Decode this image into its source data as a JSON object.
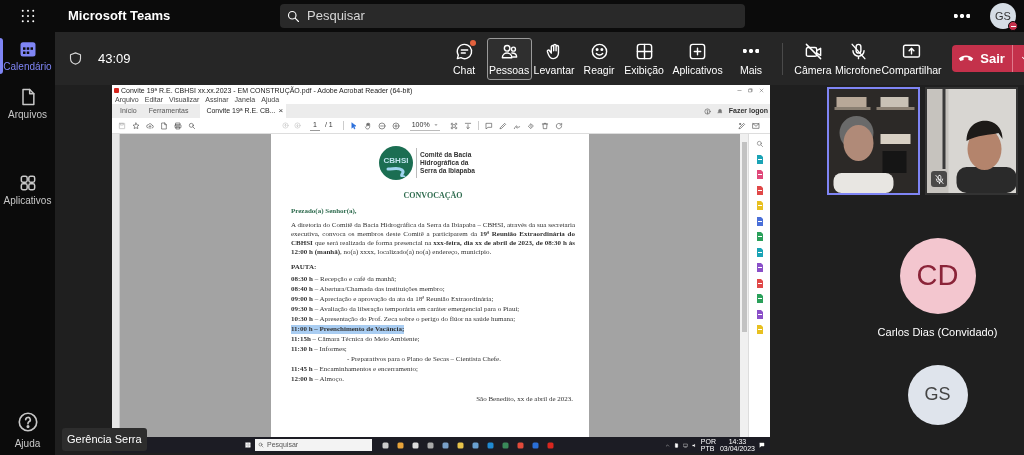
{
  "app": {
    "title": "Microsoft Teams",
    "search_placeholder": "Pesquisar",
    "avatar_initials": "GS",
    "busy": true
  },
  "rail": [
    {
      "label": "Calendário",
      "selected": true
    },
    {
      "label": "Arquivos",
      "selected": false
    },
    {
      "label": "Aplicativos",
      "selected": false
    }
  ],
  "help": "Ajuda",
  "meeting": {
    "timer": "43:09",
    "controls": [
      {
        "label": "Chat",
        "selected": false,
        "badge": true
      },
      {
        "label": "Pessoas",
        "selected": true,
        "badge": false
      },
      {
        "label": "Levantar",
        "selected": false,
        "badge": false
      },
      {
        "label": "Reagir",
        "selected": false,
        "badge": false
      },
      {
        "label": "Exibição",
        "selected": false,
        "badge": false
      },
      {
        "label": "Aplicativos",
        "selected": false,
        "badge": false
      },
      {
        "label": "Mais",
        "selected": false,
        "badge": false
      }
    ],
    "device_controls": [
      {
        "label": "Câmera",
        "selected": false,
        "badge": false
      },
      {
        "label": "Microfone",
        "selected": false,
        "badge": false
      },
      {
        "label": "Compartilhar",
        "selected": false,
        "badge": false
      }
    ],
    "leave": "Sair"
  },
  "shared_screen": {
    "window_title": "Convite 19ª R.E. CBHSI xx.xx.2023 - EM CONSTRUÇÃO.pdf - Adobe Acrobat Reader (64-bit)",
    "menu": [
      "Arquivo",
      "Editar",
      "Visualizar",
      "Assinar",
      "Janela",
      "Ajuda"
    ],
    "tabs": [
      {
        "label": "Início",
        "selected": false
      },
      {
        "label": "Ferramentas",
        "selected": false
      },
      {
        "label": "Convite 19ª R.E. CB...",
        "selected": true
      }
    ],
    "close_mark": "×",
    "sign_in": "Fazer logon",
    "page": "1",
    "page_total": "/ 1",
    "zoom": "100%",
    "document": {
      "logo_text": "CBHSI",
      "org_lines": [
        "Comitê da Bacia",
        "Hidrográfica da",
        "Serra da Ibiapaba"
      ],
      "title": "CONVOCAÇÃO",
      "greeting": "Prezado(a) Senhor(a),",
      "paragraph": "A diretoria do Comitê da Bacia Hidrográfica da Serra da Ibiapaba – CBHSI, através da sua secretaria executiva, convoca os membros deste Comitê a participarem da **19ª Reunião Extraordinária do CBHSI** que será realizada de forma presencial na **xxx-feira, dia xx de abril de 2023, de 08:30 h às 12:00 h (manhã)**, no(a) xxxx, localizado(a) no(a) endereço, município.",
      "agenda_title": "PAUTA:",
      "agenda": [
        {
          "kind": "item",
          "time": "08:30 h",
          "text": "– Recepção e café da manhã;",
          "selected": false
        },
        {
          "kind": "item",
          "time": "08:40 h",
          "text": "– Abertura/Chamada das instituições membro;",
          "selected": false
        },
        {
          "kind": "item",
          "time": "09:00 h",
          "text": "– Apreciação e aprovação da ata da 18ª Reunião Extraordinária;",
          "selected": false
        },
        {
          "kind": "item",
          "time": "09:30 h",
          "text": "– Avaliação da liberação temporária em caráter emergencial para o Piauí;",
          "selected": false
        },
        {
          "kind": "item",
          "time": "10:30 h",
          "text": "– Apresentação do Prof. Zeca sobre o perigo do flúor na saúde humana;",
          "selected": false
        },
        {
          "kind": "item",
          "time": "11:00 h",
          "text": "– Preenchimento de Vacância;",
          "selected": true
        },
        {
          "kind": "item",
          "time": "11:15h",
          "text": "– Câmara Técnica do Meio Ambiente;",
          "selected": false
        },
        {
          "kind": "item",
          "time": "11:30 h",
          "text": "– Informes;",
          "selected": false
        },
        {
          "kind": "subitem",
          "text": "- Preparativos para o Plano de Secas – Cientista Chefe.",
          "selected": false
        },
        {
          "kind": "item",
          "time": "11:45 h",
          "text": "– Encaminhamentos e encerramento;",
          "selected": false
        },
        {
          "kind": "item",
          "time": "12:00 h",
          "text": "– Almoço.",
          "selected": false
        }
      ],
      "signature": "São Benedito, xx de abril de 2023."
    },
    "taskbar": {
      "search_placeholder": "Pesquisar",
      "language": [
        "POR",
        "PTB"
      ],
      "time": "14:33",
      "date": "03/04/2023"
    }
  },
  "participants": [
    {
      "kind": "video",
      "selected": true,
      "muted": false
    },
    {
      "kind": "video",
      "selected": false,
      "muted": true
    },
    {
      "kind": "avatar",
      "initials": "CD",
      "name": "Carlos Dias (Convidado)",
      "color": "#f3c6cf"
    },
    {
      "kind": "avatar",
      "initials": "GS",
      "color": "#dfe4ec"
    }
  ],
  "tooltip": "Gerência Serra"
}
